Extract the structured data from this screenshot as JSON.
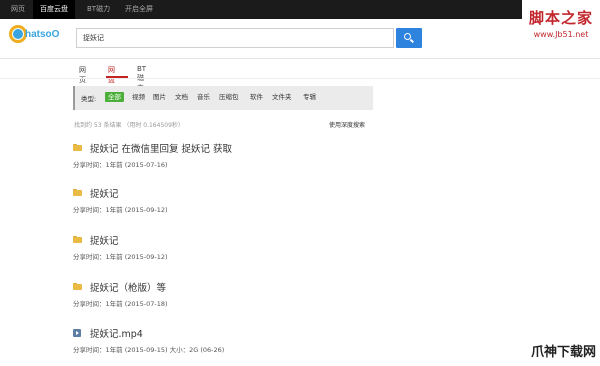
{
  "topbar": {
    "items": [
      {
        "label": "网页",
        "active": false
      },
      {
        "label": "百度云盘",
        "active": true
      },
      {
        "label": "BT磁力",
        "active": false
      },
      {
        "label": "开启全屏",
        "active": false
      }
    ]
  },
  "watermark": {
    "top_big": "脚本之家",
    "top_small": "www.Jb51.net",
    "bottom": "爪神下载网"
  },
  "logo": {
    "text": "hatsoO"
  },
  "search": {
    "value": "捉妖记"
  },
  "tabs": [
    {
      "label": "网页",
      "active": false
    },
    {
      "label": "网盘",
      "active": true
    },
    {
      "label": "BT磁力",
      "active": false
    }
  ],
  "filter": {
    "label": "类型:",
    "chips": [
      "全部",
      "视频",
      "图片",
      "文档",
      "音乐",
      "压缩包",
      "软件",
      "文件夹",
      "专辑"
    ],
    "selected": "全部"
  },
  "result_count": "找到约 53 条结果 （用时 0.164509秒）",
  "deep_search_link": "使用深度搜索",
  "results": [
    {
      "icon": "folder-icon",
      "title": "捉妖记 在微信里回复 捉妖记 获取",
      "meta": "分享时间：1年前 (2015-07-16)"
    },
    {
      "icon": "folder-icon",
      "title": "捉妖记",
      "meta": "分享时间：1年前 (2015-09-12)"
    },
    {
      "icon": "folder-icon",
      "title": "捉妖记",
      "meta": "分享时间：1年前 (2015-09-12)"
    },
    {
      "icon": "folder-icon",
      "title": "捉妖记（枪版）等",
      "meta": "分享时间：1年前 (2015-07-18)"
    },
    {
      "icon": "video-icon",
      "title": "捉妖记.mp4",
      "meta": "分享时间：1年前 (2015-09-15)  大小：2G (06-26)"
    }
  ]
}
